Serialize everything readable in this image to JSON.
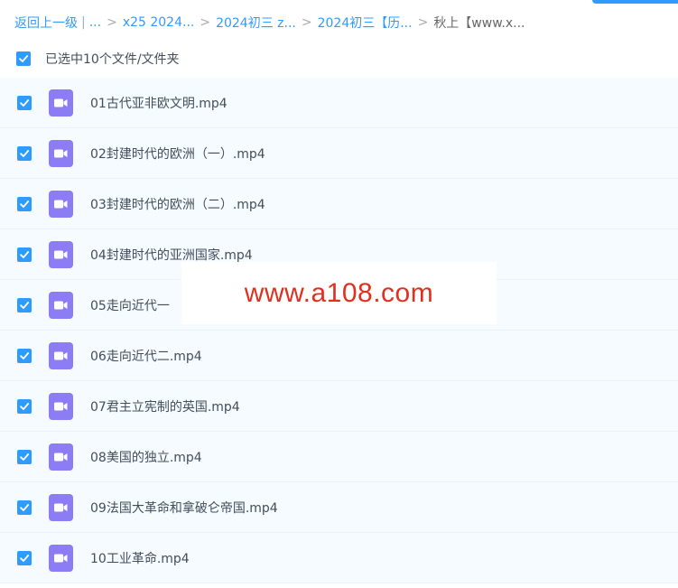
{
  "breadcrumb": {
    "back": "返回上一级",
    "pipe": "|",
    "ellipsis": "...",
    "sep": ">",
    "items": [
      {
        "label": "x25 2024..."
      },
      {
        "label": "2024初三 z..."
      },
      {
        "label": "2024初三【历..."
      }
    ],
    "current": "秋上【www.x..."
  },
  "selection": {
    "text": "已选中10个文件/文件夹",
    "checked": true
  },
  "files": [
    {
      "name": "01古代亚非欧文明.mp4",
      "checked": true,
      "icon": "video-file-icon"
    },
    {
      "name": "02封建时代的欧洲（一）.mp4",
      "checked": true,
      "icon": "video-file-icon"
    },
    {
      "name": "03封建时代的欧洲（二）.mp4",
      "checked": true,
      "icon": "video-file-icon"
    },
    {
      "name": "04封建时代的亚洲国家.mp4",
      "checked": true,
      "icon": "video-file-icon"
    },
    {
      "name": "05走向近代一",
      "checked": true,
      "icon": "video-file-icon"
    },
    {
      "name": "06走向近代二.mp4",
      "checked": true,
      "icon": "video-file-icon"
    },
    {
      "name": "07君主立宪制的英国.mp4",
      "checked": true,
      "icon": "video-file-icon"
    },
    {
      "name": "08美国的独立.mp4",
      "checked": true,
      "icon": "video-file-icon"
    },
    {
      "name": "09法国大革命和拿破仑帝国.mp4",
      "checked": true,
      "icon": "video-file-icon"
    },
    {
      "name": "10工业革命.mp4",
      "checked": true,
      "icon": "video-file-icon"
    }
  ],
  "watermark": {
    "text": "www.a108.com"
  },
  "colors": {
    "accent": "#2f9bff",
    "row_background": "#f5fbff",
    "video_icon": "#8c7df4",
    "watermark_text": "#e03020"
  }
}
